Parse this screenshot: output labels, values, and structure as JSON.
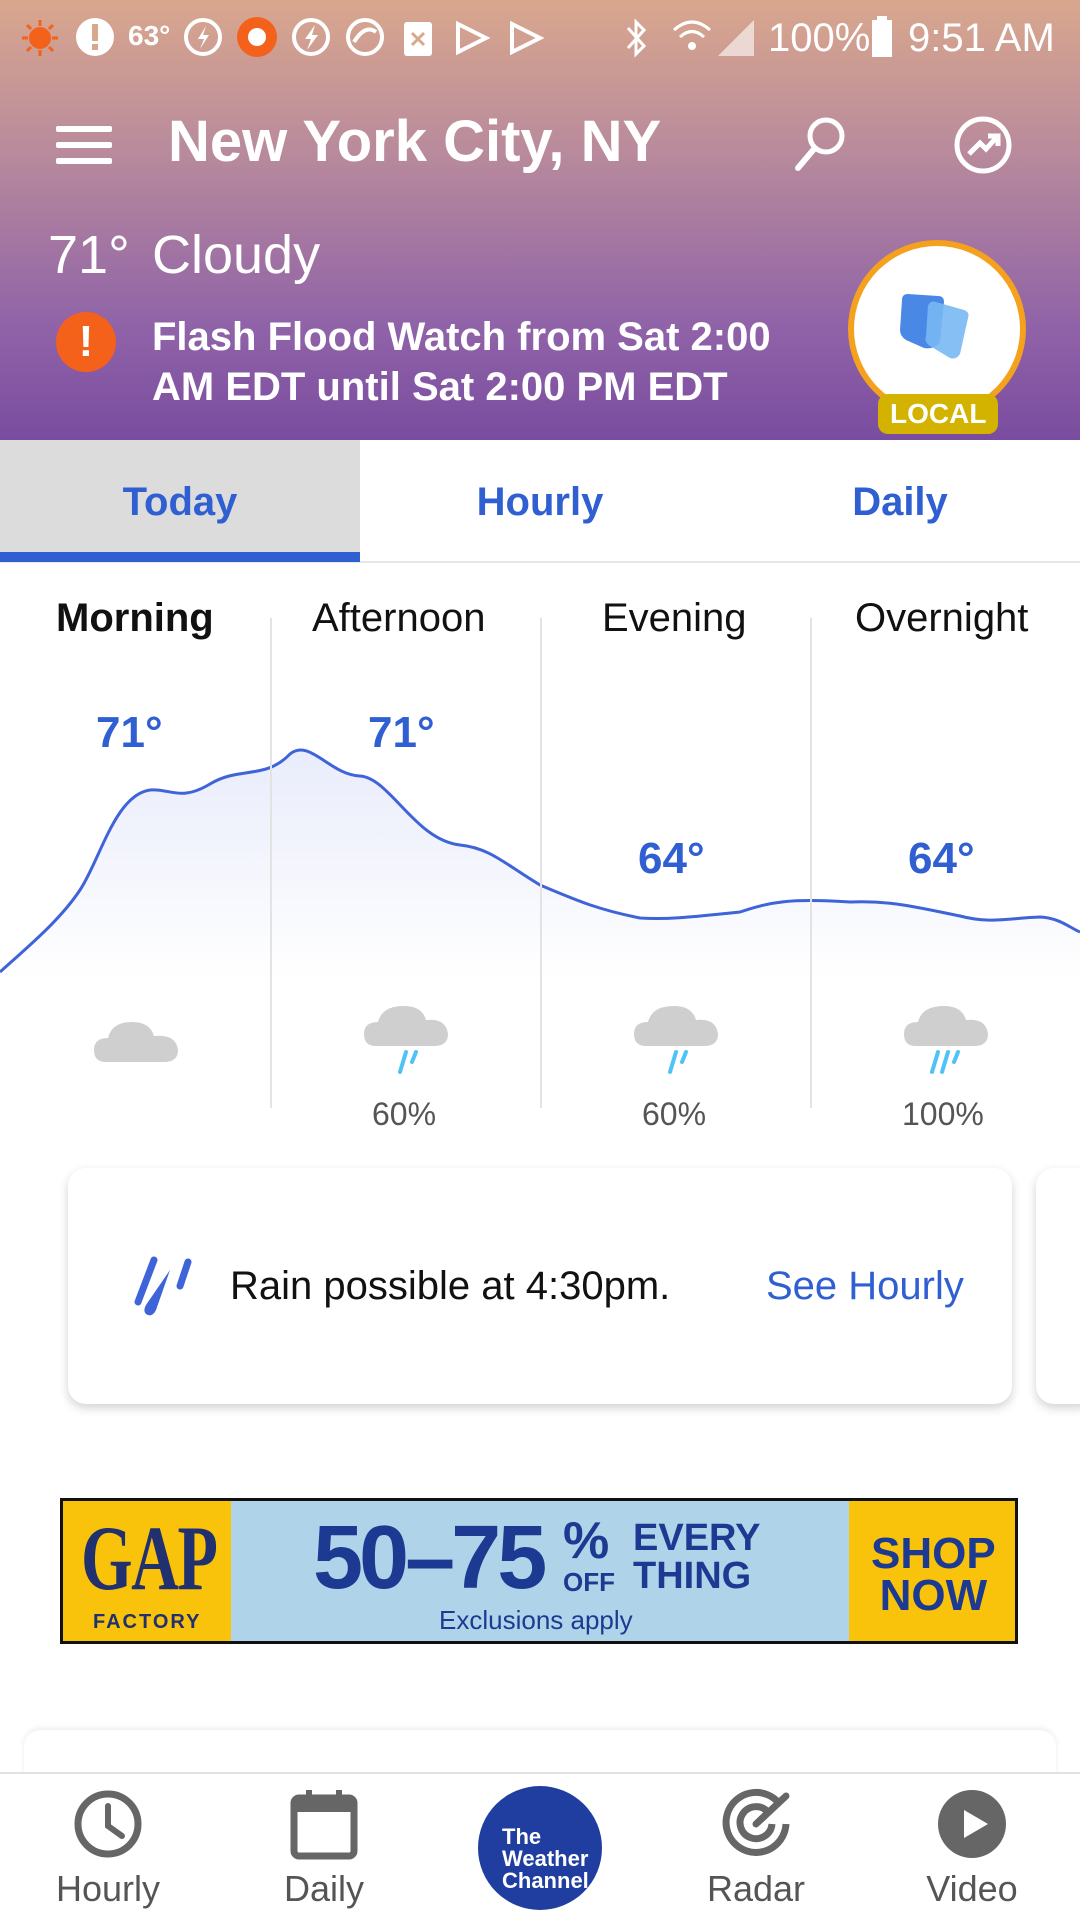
{
  "status_bar": {
    "temp": "63°",
    "battery": "100%",
    "time": "9:51 AM"
  },
  "header": {
    "city": "New York City, NY",
    "current_temp": "71°",
    "condition": "Cloudy",
    "alert": "Flash Flood Watch from Sat 2:00 AM EDT until Sat 2:00 PM EDT",
    "local_badge": "LOCAL"
  },
  "tabs": [
    {
      "label": "Today",
      "selected": true
    },
    {
      "label": "Hourly",
      "selected": false
    },
    {
      "label": "Daily",
      "selected": false
    }
  ],
  "forecast": {
    "periods": [
      {
        "name": "Morning",
        "temp": "71°",
        "icon": "cloud-icon",
        "precip": ""
      },
      {
        "name": "Afternoon",
        "temp": "71°",
        "icon": "rain-cloud-icon",
        "precip": "60%"
      },
      {
        "name": "Evening",
        "temp": "64°",
        "icon": "rain-cloud-icon",
        "precip": "60%"
      },
      {
        "name": "Overnight",
        "temp": "64°",
        "icon": "rain-cloud-icon",
        "precip": "100%"
      }
    ]
  },
  "rain_card": {
    "message": "Rain possible at 4:30pm.",
    "link": "See Hourly"
  },
  "ad": {
    "brand": "GAP",
    "brand_sub": "FACTORY",
    "discount": "50–75",
    "percent": "%",
    "off": "OFF",
    "every_line1": "EVERY",
    "every_line2": "THING",
    "exclusions": "Exclusions apply",
    "cta_line1": "SHOP",
    "cta_line2": "NOW"
  },
  "bottom_nav": {
    "items": [
      {
        "label": "Hourly",
        "icon": "clock-icon"
      },
      {
        "label": "Daily",
        "icon": "calendar-icon"
      },
      {
        "label": "Radar",
        "icon": "radar-icon"
      },
      {
        "label": "Video",
        "icon": "play-icon"
      }
    ],
    "logo_line1": "The",
    "logo_line2": "Weather",
    "logo_line3": "Channel"
  },
  "colors": {
    "accent": "#2f5fd0",
    "alert": "#f4611b",
    "local_ring": "#f4a21d",
    "rain_drop": "#4fc3f7"
  }
}
